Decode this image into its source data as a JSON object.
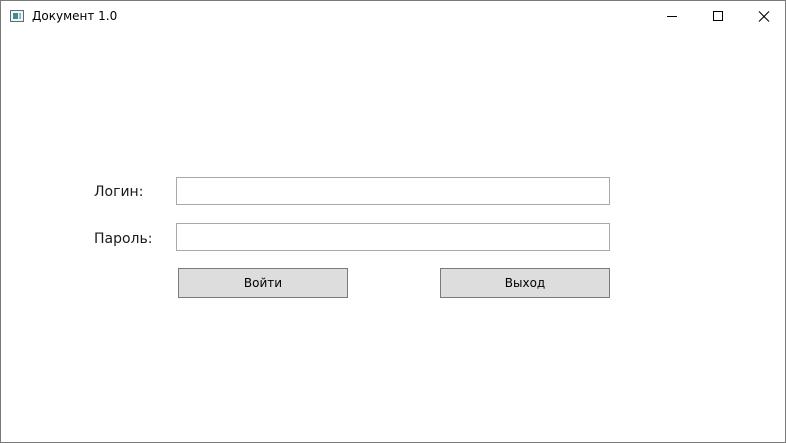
{
  "window": {
    "title": "Документ 1.0",
    "icons": {
      "app": "window-app-icon",
      "minimize": "minimize-icon",
      "maximize": "maximize-icon",
      "close": "close-icon"
    }
  },
  "form": {
    "login_label": "Логин:",
    "login_value": "",
    "password_label": "Пароль:",
    "password_value": "",
    "submit_label": "Войти",
    "exit_label": "Выход"
  },
  "colors": {
    "button_bg": "#dddddd",
    "field_border": "#a9a9a9",
    "window_border": "#7a7a7a"
  }
}
